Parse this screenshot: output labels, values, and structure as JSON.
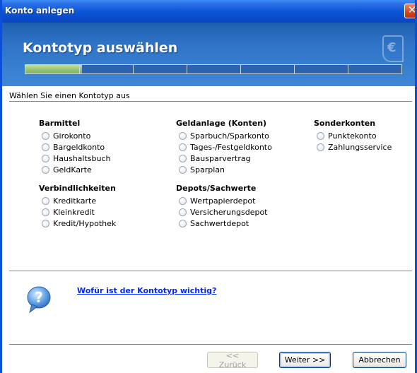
{
  "window": {
    "title": "Konto anlegen"
  },
  "header": {
    "heading": "Kontotyp auswählen",
    "logo_glyph": "€",
    "progress": 0.15
  },
  "subtitle": "Wählen Sie einen Kontotyp aus",
  "groups": [
    {
      "title": "Barmittel",
      "options": [
        "Girokonto",
        "Bargeldkonto",
        "Haushaltsbuch",
        "GeldKarte"
      ]
    },
    {
      "title": "Verbindlichkeiten",
      "options": [
        "Kreditkarte",
        "Kleinkredit",
        "Kredit/Hypothek"
      ]
    },
    {
      "title": "Geldanlage (Konten)",
      "options": [
        "Sparbuch/Sparkonto",
        "Tages-/Festgeldkonto",
        "Bausparvertrag",
        "Sparplan"
      ]
    },
    {
      "title": "Depots/Sachwerte",
      "options": [
        "Wertpapierdepot",
        "Versicherungsdepot",
        "Sachwertdepot"
      ]
    },
    {
      "title": "Sonderkonten",
      "options": [
        "Punktekonto",
        "Zahlungsservice"
      ]
    }
  ],
  "help": {
    "link": "Wofür ist der Kontotyp wichtig?",
    "icon": "question-icon"
  },
  "buttons": {
    "back": "<< Zurück",
    "next": "Weiter >>",
    "cancel": "Abbrechen"
  },
  "colors": {
    "titlebar": "#0b56d8",
    "banner": "#2f74c7",
    "link": "#0026ff",
    "progress_fill": "#9cc475"
  }
}
